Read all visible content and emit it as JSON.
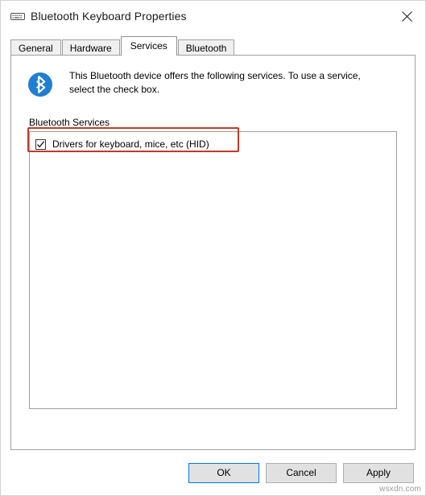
{
  "window": {
    "title": "Bluetooth Keyboard Properties",
    "title_icon": "bluetooth-keyboard-icon",
    "close_icon": "close-icon"
  },
  "tabs": [
    {
      "label": "General",
      "active": false
    },
    {
      "label": "Hardware",
      "active": false
    },
    {
      "label": "Services",
      "active": true
    },
    {
      "label": "Bluetooth",
      "active": false
    }
  ],
  "services_tab": {
    "icon": "bluetooth-icon",
    "description": "This Bluetooth device offers the following services. To use a service, select the check box.",
    "group_label": "Bluetooth Services",
    "services": [
      {
        "label": "Drivers for keyboard, mice, etc (HID)",
        "checked": true
      }
    ],
    "highlight_color": "#c0392b"
  },
  "footer": {
    "ok_label": "OK",
    "cancel_label": "Cancel",
    "apply_label": "Apply"
  },
  "watermark": "wsxdn.com"
}
